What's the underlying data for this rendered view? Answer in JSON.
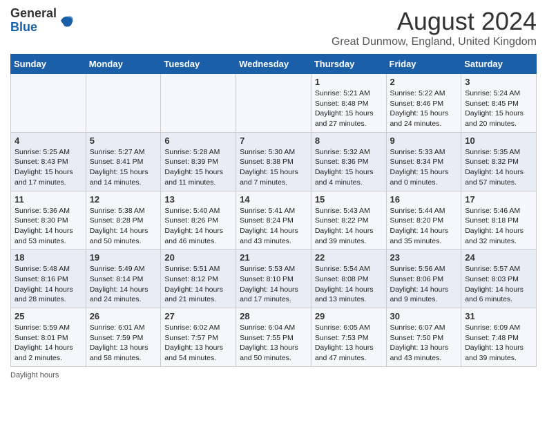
{
  "header": {
    "logo_general": "General",
    "logo_blue": "Blue",
    "month_title": "August 2024",
    "location": "Great Dunmow, England, United Kingdom"
  },
  "weekdays": [
    "Sunday",
    "Monday",
    "Tuesday",
    "Wednesday",
    "Thursday",
    "Friday",
    "Saturday"
  ],
  "weeks": [
    [
      {
        "day": "",
        "info": ""
      },
      {
        "day": "",
        "info": ""
      },
      {
        "day": "",
        "info": ""
      },
      {
        "day": "",
        "info": ""
      },
      {
        "day": "1",
        "info": "Sunrise: 5:21 AM\nSunset: 8:48 PM\nDaylight: 15 hours\nand 27 minutes."
      },
      {
        "day": "2",
        "info": "Sunrise: 5:22 AM\nSunset: 8:46 PM\nDaylight: 15 hours\nand 24 minutes."
      },
      {
        "day": "3",
        "info": "Sunrise: 5:24 AM\nSunset: 8:45 PM\nDaylight: 15 hours\nand 20 minutes."
      }
    ],
    [
      {
        "day": "4",
        "info": "Sunrise: 5:25 AM\nSunset: 8:43 PM\nDaylight: 15 hours\nand 17 minutes."
      },
      {
        "day": "5",
        "info": "Sunrise: 5:27 AM\nSunset: 8:41 PM\nDaylight: 15 hours\nand 14 minutes."
      },
      {
        "day": "6",
        "info": "Sunrise: 5:28 AM\nSunset: 8:39 PM\nDaylight: 15 hours\nand 11 minutes."
      },
      {
        "day": "7",
        "info": "Sunrise: 5:30 AM\nSunset: 8:38 PM\nDaylight: 15 hours\nand 7 minutes."
      },
      {
        "day": "8",
        "info": "Sunrise: 5:32 AM\nSunset: 8:36 PM\nDaylight: 15 hours\nand 4 minutes."
      },
      {
        "day": "9",
        "info": "Sunrise: 5:33 AM\nSunset: 8:34 PM\nDaylight: 15 hours\nand 0 minutes."
      },
      {
        "day": "10",
        "info": "Sunrise: 5:35 AM\nSunset: 8:32 PM\nDaylight: 14 hours\nand 57 minutes."
      }
    ],
    [
      {
        "day": "11",
        "info": "Sunrise: 5:36 AM\nSunset: 8:30 PM\nDaylight: 14 hours\nand 53 minutes."
      },
      {
        "day": "12",
        "info": "Sunrise: 5:38 AM\nSunset: 8:28 PM\nDaylight: 14 hours\nand 50 minutes."
      },
      {
        "day": "13",
        "info": "Sunrise: 5:40 AM\nSunset: 8:26 PM\nDaylight: 14 hours\nand 46 minutes."
      },
      {
        "day": "14",
        "info": "Sunrise: 5:41 AM\nSunset: 8:24 PM\nDaylight: 14 hours\nand 43 minutes."
      },
      {
        "day": "15",
        "info": "Sunrise: 5:43 AM\nSunset: 8:22 PM\nDaylight: 14 hours\nand 39 minutes."
      },
      {
        "day": "16",
        "info": "Sunrise: 5:44 AM\nSunset: 8:20 PM\nDaylight: 14 hours\nand 35 minutes."
      },
      {
        "day": "17",
        "info": "Sunrise: 5:46 AM\nSunset: 8:18 PM\nDaylight: 14 hours\nand 32 minutes."
      }
    ],
    [
      {
        "day": "18",
        "info": "Sunrise: 5:48 AM\nSunset: 8:16 PM\nDaylight: 14 hours\nand 28 minutes."
      },
      {
        "day": "19",
        "info": "Sunrise: 5:49 AM\nSunset: 8:14 PM\nDaylight: 14 hours\nand 24 minutes."
      },
      {
        "day": "20",
        "info": "Sunrise: 5:51 AM\nSunset: 8:12 PM\nDaylight: 14 hours\nand 21 minutes."
      },
      {
        "day": "21",
        "info": "Sunrise: 5:53 AM\nSunset: 8:10 PM\nDaylight: 14 hours\nand 17 minutes."
      },
      {
        "day": "22",
        "info": "Sunrise: 5:54 AM\nSunset: 8:08 PM\nDaylight: 14 hours\nand 13 minutes."
      },
      {
        "day": "23",
        "info": "Sunrise: 5:56 AM\nSunset: 8:06 PM\nDaylight: 14 hours\nand 9 minutes."
      },
      {
        "day": "24",
        "info": "Sunrise: 5:57 AM\nSunset: 8:03 PM\nDaylight: 14 hours\nand 6 minutes."
      }
    ],
    [
      {
        "day": "25",
        "info": "Sunrise: 5:59 AM\nSunset: 8:01 PM\nDaylight: 14 hours\nand 2 minutes."
      },
      {
        "day": "26",
        "info": "Sunrise: 6:01 AM\nSunset: 7:59 PM\nDaylight: 13 hours\nand 58 minutes."
      },
      {
        "day": "27",
        "info": "Sunrise: 6:02 AM\nSunset: 7:57 PM\nDaylight: 13 hours\nand 54 minutes."
      },
      {
        "day": "28",
        "info": "Sunrise: 6:04 AM\nSunset: 7:55 PM\nDaylight: 13 hours\nand 50 minutes."
      },
      {
        "day": "29",
        "info": "Sunrise: 6:05 AM\nSunset: 7:53 PM\nDaylight: 13 hours\nand 47 minutes."
      },
      {
        "day": "30",
        "info": "Sunrise: 6:07 AM\nSunset: 7:50 PM\nDaylight: 13 hours\nand 43 minutes."
      },
      {
        "day": "31",
        "info": "Sunrise: 6:09 AM\nSunset: 7:48 PM\nDaylight: 13 hours\nand 39 minutes."
      }
    ]
  ],
  "footer": {
    "daylight_label": "Daylight hours"
  }
}
